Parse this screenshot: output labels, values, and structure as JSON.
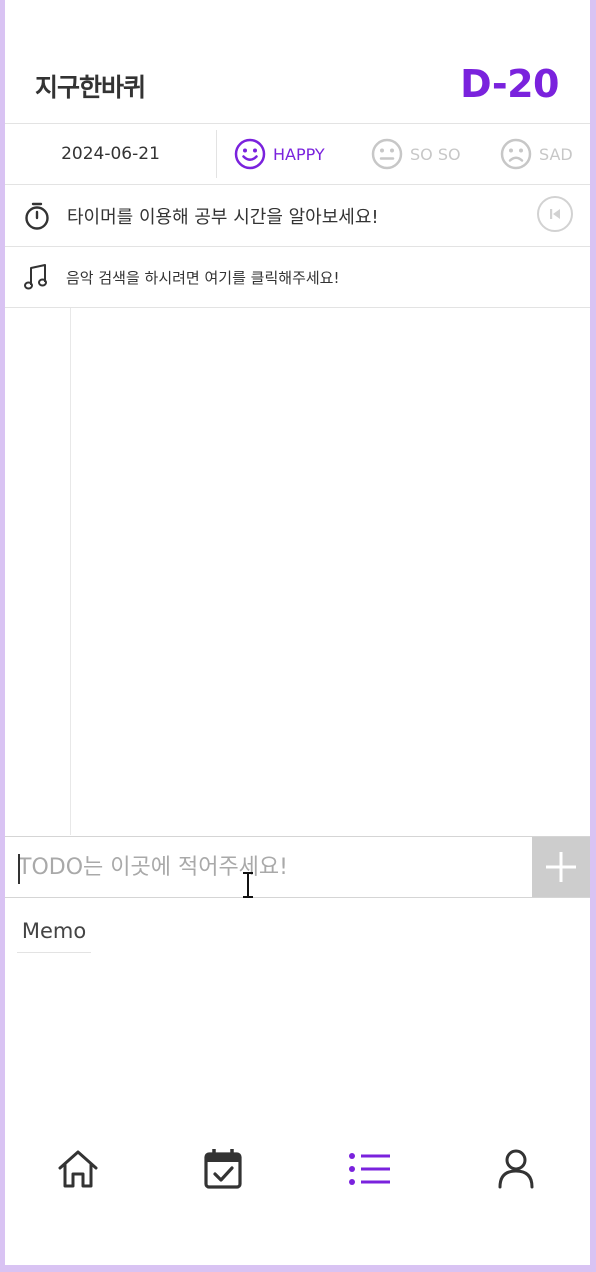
{
  "header": {
    "app_title": "지구한바퀴",
    "dday": "D-20"
  },
  "mood": {
    "date": "2024-06-21",
    "options": [
      {
        "label": "HAPPY",
        "icon": "happy-face-icon",
        "selected": true
      },
      {
        "label": "SO SO",
        "icon": "neutral-face-icon",
        "selected": false
      },
      {
        "label": "SAD",
        "icon": "sad-face-icon",
        "selected": false
      }
    ]
  },
  "timer": {
    "text": "타이머를 이용해 공부 시간을 알아보세요!",
    "icon": "stopwatch-icon",
    "reset_icon": "skip-back-icon"
  },
  "music": {
    "text": "음악 검색을 하시려면 여기를 클릭해주세요!",
    "icon": "music-note-icon"
  },
  "todo": {
    "placeholder": "TODO는 이곳에 적어주세요!",
    "value": "",
    "add_icon": "plus-icon"
  },
  "memo": {
    "tab_label": "Memo"
  },
  "nav": {
    "items": [
      {
        "icon": "home-icon",
        "active": false
      },
      {
        "icon": "calendar-check-icon",
        "active": false
      },
      {
        "icon": "list-icon",
        "active": true
      },
      {
        "icon": "user-icon",
        "active": false
      }
    ]
  },
  "colors": {
    "accent": "#7a22dd",
    "inactive": "#c7c7c7",
    "frame": "#d9c3f3",
    "add_button": "#cdcdcd"
  }
}
